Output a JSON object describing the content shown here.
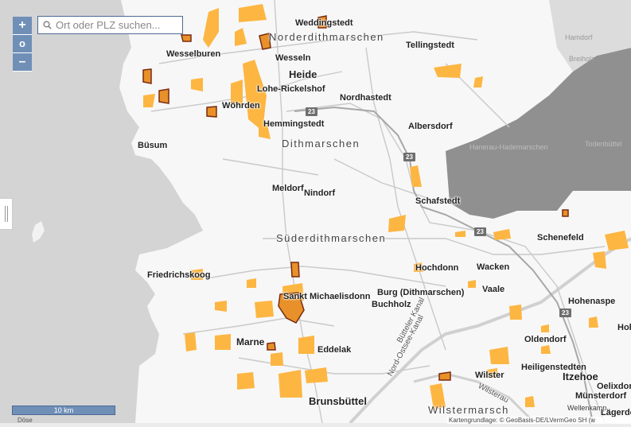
{
  "map": {
    "search": {
      "placeholder": "Ort oder PLZ suchen..."
    },
    "zoom": {
      "in": "+",
      "home": "o",
      "out": "–"
    },
    "scale_label": "10 km",
    "attribution": "Kartengrundlage: © GeoBasis-DE/LVermGeo SH (w",
    "edge_text": "Döse",
    "road_shields": [
      "23",
      "23",
      "23",
      "23"
    ],
    "places": {
      "weddingstedt": "Weddingstedt",
      "norderdithmarschen": "Norderdithmarschen",
      "wesselburen": "Wesselburen",
      "wesseln": "Wesseln",
      "heide": "Heide",
      "tellingstedt": "Tellingstedt",
      "hanstorf": "Hamdorf",
      "breiholz": "Breiholz",
      "lohe_rickelshof": "Lohe-Rickelshof",
      "woehrden": "Wöhrden",
      "nordhastedt": "Nordhastedt",
      "hemmingstedt": "Hemmingstedt",
      "albersdorf": "Albersdorf",
      "buesum": "Büsum",
      "dithmarschen": "Dithmarschen",
      "hanerau": "Hanerau-Hademarschen",
      "todenbuettel": "Todenbüttel",
      "meldorf": "Meldorf",
      "nindorf": "Nindorf",
      "schafstedt": "Schafstedt",
      "suederdithmarschen": "Süderdithmarschen",
      "schenefeld": "Schenefeld",
      "friedrichskoog": "Friedrichskoog",
      "hochdonn": "Hochdonn",
      "wacken": "Wacken",
      "st_michaelisdonn": "Sankt Michaelisdonn",
      "burg": "Burg (Dithmarschen)",
      "buchholz": "Buchholz",
      "vaale": "Vaale",
      "hohenaspe": "Hohenaspe",
      "hoh": "Hoh",
      "marne": "Marne",
      "eddelak": "Eddelak",
      "oldendorf": "Oldendorf",
      "heiligenstedten": "Heiligenstedten",
      "itzehoe": "Itzehoe",
      "oelixdorf": "Oelixdorf",
      "muensterdorf": "Münsterdorf",
      "wellenkamp": "Wellenkamp",
      "laegerdorf": "Lägerdor",
      "wilster": "Wilster",
      "wilstermarsch": "Wilstermarsch",
      "brunsbuettel": "Brunsbüttel",
      "buetteler_kanal": "Bütteler Kanal",
      "nord_ostsee_kanal": "Nord-Ostsee-Kanal",
      "wilsterau": "Wilsterau"
    }
  },
  "colors": {
    "land": "#f7f7f7",
    "water": "#d2d2d2",
    "highlight": "#fdb642",
    "outlined": "#e8912a",
    "outline": "#7a2a10",
    "outside": "#8f8f8f",
    "control": "#6f8fb7"
  }
}
